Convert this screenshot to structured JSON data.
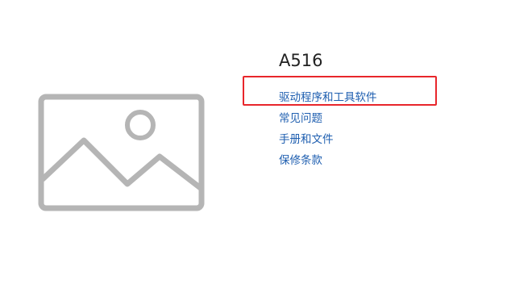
{
  "product": {
    "title": "A516",
    "image_icon": "image-placeholder-icon"
  },
  "links": [
    {
      "label": "驱动程序和工具软件",
      "highlighted": true
    },
    {
      "label": "常见问题",
      "highlighted": false
    },
    {
      "label": "手册和文件",
      "highlighted": false
    },
    {
      "label": "保修条款",
      "highlighted": false
    }
  ],
  "colors": {
    "link": "#1f5fb0",
    "title": "#222222",
    "highlight_border": "#e8262b",
    "placeholder_gray": "#b5b5b5"
  }
}
